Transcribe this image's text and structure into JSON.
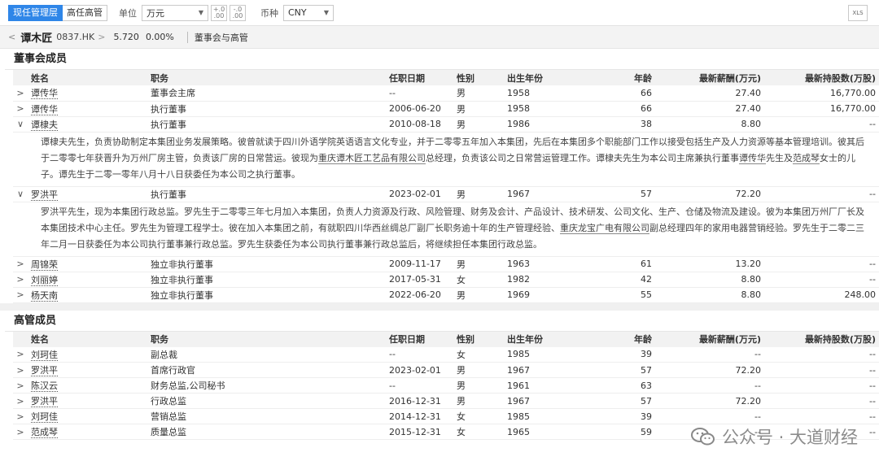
{
  "toolbar": {
    "tabs": [
      "现任管理层",
      "高任高管"
    ],
    "unit_label": "单位",
    "unit_value": "万元",
    "currency_label": "币种",
    "currency_value": "CNY",
    "dec_up_glyph": "+.0\n.00",
    "dec_down_glyph": "-.0\n.00",
    "export_label": "XLS"
  },
  "crumb": {
    "back": "<",
    "name": "谭木匠",
    "code": "0837.HK",
    "forward": ">",
    "price": "5.720",
    "change": "0.00%",
    "section": "董事会与高管"
  },
  "columns": [
    "姓名",
    "职务",
    "任职日期",
    "性别",
    "出生年份",
    "年龄",
    "最新薪酬(万元)",
    "最新持股数(万股)"
  ],
  "board": {
    "title": "董事会成员",
    "rows": [
      {
        "exp": ">",
        "name": "谭传华",
        "role": "董事会主席",
        "date": "--",
        "sex": "男",
        "birth": "1958",
        "age": "66",
        "salary": "27.40",
        "shares": "16,770.00"
      },
      {
        "exp": ">",
        "name": "谭传华",
        "role": "执行董事",
        "date": "2006-06-20",
        "sex": "男",
        "birth": "1958",
        "age": "66",
        "salary": "27.40",
        "shares": "16,770.00"
      },
      {
        "exp": "∨",
        "name": "谭棣夫",
        "role": "执行董事",
        "date": "2010-08-18",
        "sex": "男",
        "birth": "1986",
        "age": "38",
        "salary": "8.80",
        "shares": "--"
      },
      {
        "exp": "∨",
        "name": "罗洪平",
        "role": "执行董事",
        "date": "2023-02-01",
        "sex": "男",
        "birth": "1967",
        "age": "57",
        "salary": "72.20",
        "shares": "--"
      },
      {
        "exp": ">",
        "name": "周锦荣",
        "role": "独立非执行董事",
        "date": "2009-11-17",
        "sex": "男",
        "birth": "1963",
        "age": "61",
        "salary": "13.20",
        "shares": "--"
      },
      {
        "exp": ">",
        "name": "刘丽婷",
        "role": "独立非执行董事",
        "date": "2017-05-31",
        "sex": "女",
        "birth": "1982",
        "age": "42",
        "salary": "8.80",
        "shares": "--"
      },
      {
        "exp": ">",
        "name": "杨天南",
        "role": "独立非执行董事",
        "date": "2022-06-20",
        "sex": "男",
        "birth": "1969",
        "age": "55",
        "salary": "8.80",
        "shares": "248.00"
      }
    ],
    "bio_tan": {
      "p1": "谭棣夫先生，负责协助制定本集团业务发展策略。彼曾就读于四川外语学院英语语言文化专业，并于二零零五年加入本集团，先后在本集团多个职能部门工作以接受包括生产及人力资源等基本管理培训。彼其后于二零零七年获晋升为万州厂房主管，负责该厂房的日常营运。彼现为",
      "link1": "重庆谭木匠工艺品有限公司",
      "p2": "总经理，负责该公司之日常营运管理工作。谭棣夫先生为本公司主席兼执行董事",
      "link2": "谭传华",
      "p3": "先生及",
      "link3": "范成琴",
      "p4": "女士的儿子。谭先生于二零一零年八月十八日获委任为本公司之执行董事。"
    },
    "bio_luo": {
      "p1": "罗洪平先生，现为本集团行政总监。罗先生于二零零三年七月加入本集团，负责人力资源及行政、风险管理、财务及会计、产品设计、技术研发、公司文化、生产、仓储及物流及建设。彼为本集团万州厂厂长及本集团技术中心主任。罗先生为管理工程学士。彼在加入本集团之前，有就职四川华西丝绸总厂副厂长职务逾十年的生产管理经验、",
      "link1": "重庆龙宝广电有限公司",
      "p2": "副总经理四年的家用电器营销经验。罗先生于二零二三年二月一日获委任为本公司执行董事兼行政总监。罗先生获委任为本公司执行董事兼行政总监后，将继续担任本集团行政总监。"
    }
  },
  "mgmt": {
    "title": "高管成员",
    "rows": [
      {
        "exp": ">",
        "name": "刘珂佳",
        "role": "副总裁",
        "date": "--",
        "sex": "女",
        "birth": "1985",
        "age": "39",
        "salary": "--",
        "shares": "--"
      },
      {
        "exp": ">",
        "name": "罗洪平",
        "role": "首席行政官",
        "date": "2023-02-01",
        "sex": "男",
        "birth": "1967",
        "age": "57",
        "salary": "72.20",
        "shares": "--"
      },
      {
        "exp": ">",
        "name": "陈汉云",
        "role": "财务总监,公司秘书",
        "date": "--",
        "sex": "男",
        "birth": "1961",
        "age": "63",
        "salary": "--",
        "shares": "--"
      },
      {
        "exp": ">",
        "name": "罗洪平",
        "role": "行政总监",
        "date": "2016-12-31",
        "sex": "男",
        "birth": "1967",
        "age": "57",
        "salary": "72.20",
        "shares": "--"
      },
      {
        "exp": ">",
        "name": "刘珂佳",
        "role": "营销总监",
        "date": "2014-12-31",
        "sex": "女",
        "birth": "1985",
        "age": "39",
        "salary": "--",
        "shares": "--"
      },
      {
        "exp": ">",
        "name": "范成琴",
        "role": "质量总监",
        "date": "2015-12-31",
        "sex": "女",
        "birth": "1965",
        "age": "59",
        "salary": "--",
        "shares": "--"
      }
    ]
  },
  "watermark": "公众号 · 大道财经"
}
